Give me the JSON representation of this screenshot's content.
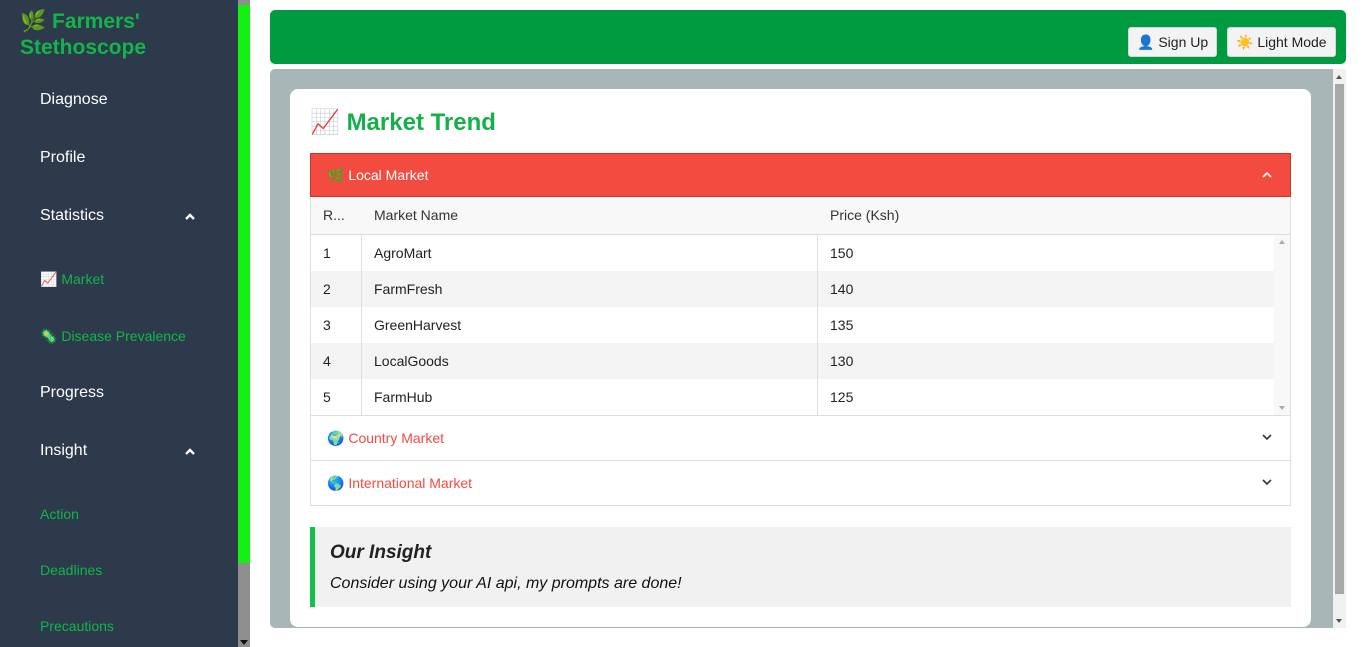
{
  "brand": {
    "icon": "🌿",
    "line1": "Farmers'",
    "line2": "Stethoscope"
  },
  "sidebar": {
    "items": [
      {
        "label": "Diagnose"
      },
      {
        "label": "Profile"
      },
      {
        "label": "Statistics"
      },
      {
        "label": "Progress"
      },
      {
        "label": "Insight"
      }
    ],
    "statistics_sub": [
      {
        "icon": "📈",
        "label": "Market"
      },
      {
        "icon": "🦠",
        "label": "Disease Prevalence"
      }
    ],
    "insight_sub": [
      {
        "label": "Action"
      },
      {
        "label": "Deadlines"
      },
      {
        "label": "Precautions"
      }
    ]
  },
  "topbar": {
    "signup_icon": "👤",
    "signup_label": "Sign Up",
    "light_icon": "☀️",
    "light_label": "Light Mode"
  },
  "main": {
    "title_icon": "📈",
    "title": "Market Trend",
    "local": {
      "icon": "🌿",
      "label": "Local Market",
      "columns": [
        "R...",
        "Market Name",
        "Price (Ksh)"
      ],
      "rows": [
        {
          "rank": "1",
          "name": "AgroMart",
          "price": "150"
        },
        {
          "rank": "2",
          "name": "FarmFresh",
          "price": "140"
        },
        {
          "rank": "3",
          "name": "GreenHarvest",
          "price": "135"
        },
        {
          "rank": "4",
          "name": "LocalGoods",
          "price": "130"
        },
        {
          "rank": "5",
          "name": "FarmHub",
          "price": "125"
        }
      ]
    },
    "country": {
      "icon": "🌍",
      "label": "Country Market"
    },
    "international": {
      "icon": "🌎",
      "label": "International Market"
    },
    "insight": {
      "title": "Our Insight",
      "text": "Consider using your AI api, my prompts are done!"
    }
  },
  "colors": {
    "brand_green": "#13b54a",
    "topbar_green": "#009a40",
    "sidebar_bg": "#2c3a4b",
    "accordion_active": "#f44b41",
    "panel_bg": "#a9b6b7"
  }
}
